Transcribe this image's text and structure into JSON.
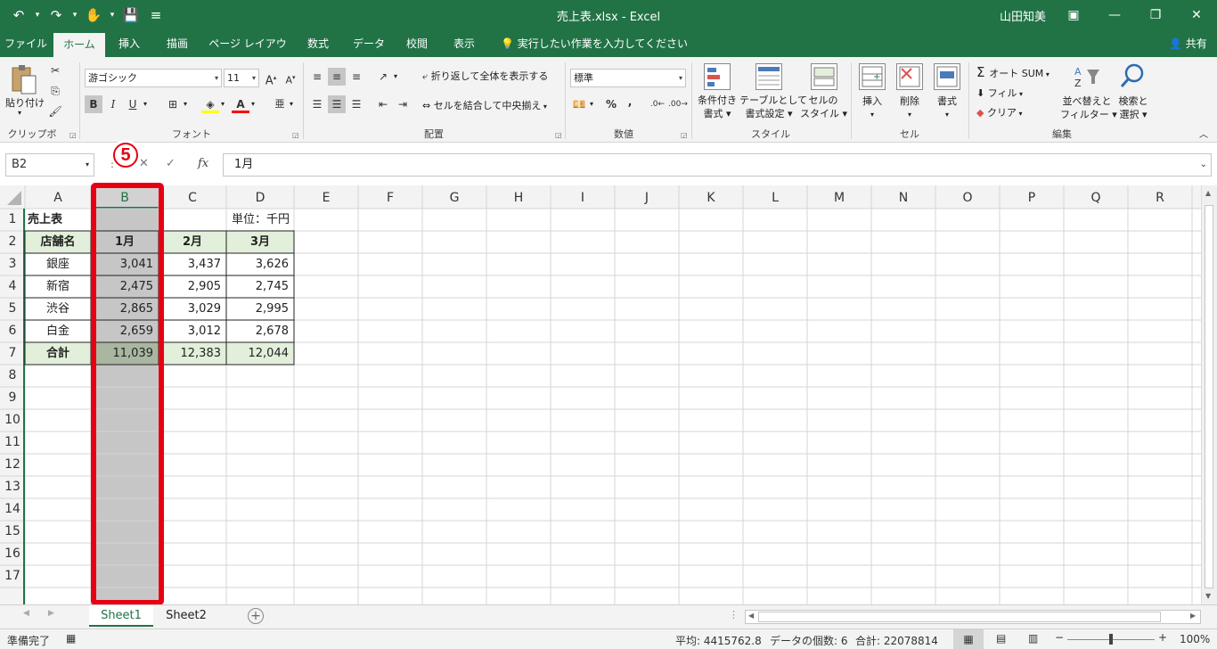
{
  "titlebar": {
    "qat_undo": "↶",
    "qat_redo": "↷",
    "qat_touch": "✋",
    "qat_save": "💾",
    "qat_more": "≡",
    "title": "売上表.xlsx  -  Excel",
    "user": "山田知美",
    "ribbon_display_icon": "▣",
    "minimize": "—",
    "restore": "❐",
    "close": "✕"
  },
  "tabs": [
    "ファイル",
    "ホーム",
    "挿入",
    "描画",
    "ページ レイアウト",
    "数式",
    "データ",
    "校閲",
    "表示"
  ],
  "tell_me": "実行したい作業を入力してください",
  "share": "共有",
  "ribbon": {
    "clipboard": {
      "paste": "貼り付け",
      "label": "クリップボード"
    },
    "font": {
      "name": "游ゴシック",
      "size": "11",
      "bold": "B",
      "italic": "I",
      "underline": "U",
      "grow": "A",
      "shrink": "A",
      "label": "フォント"
    },
    "alignment": {
      "wrap": "折り返して全体を表示する",
      "merge": "セルを結合して中央揃え",
      "label": "配置"
    },
    "number": {
      "format": "標準",
      "percent": "%",
      "comma": ",",
      "label": "数値"
    },
    "styles": {
      "conditional": [
        "条件付き",
        "書式"
      ],
      "table": [
        "テーブルとして",
        "書式設定"
      ],
      "cell": [
        "セルの",
        "スタイル"
      ],
      "label": "スタイル"
    },
    "cells": {
      "insert": "挿入",
      "delete": "削除",
      "format": "書式",
      "label": "セル"
    },
    "editing": {
      "autosum": "オート SUM",
      "fill": "フィル",
      "clear": "クリア",
      "sort": [
        "並べ替えと",
        "フィルター"
      ],
      "find": [
        "検索と",
        "選択"
      ],
      "label": "編集"
    }
  },
  "formula_bar": {
    "name_box": "B2",
    "formula": "1月",
    "fx": "fx"
  },
  "marker": "5",
  "columns": [
    "A",
    "B",
    "C",
    "D",
    "E",
    "F",
    "G",
    "H",
    "I",
    "J",
    "K",
    "L",
    "M",
    "N",
    "O",
    "P",
    "Q",
    "R"
  ],
  "rows": [
    "1",
    "2",
    "3",
    "4",
    "5",
    "6",
    "7",
    "8",
    "9",
    "10",
    "11",
    "12",
    "13",
    "14",
    "15",
    "16",
    "17"
  ],
  "cells": {
    "A1": "売上表",
    "D1": "単位：千円",
    "A2": "店舗名",
    "B2": "1月",
    "C2": "2月",
    "D2": "3月",
    "A3": "銀座",
    "B3": "3,041",
    "C3": "3,437",
    "D3": "3,626",
    "A4": "新宿",
    "B4": "2,475",
    "C4": "2,905",
    "D4": "2,745",
    "A5": "渋谷",
    "B5": "2,865",
    "C5": "3,029",
    "D5": "2,995",
    "A6": "白金",
    "B6": "2,659",
    "C6": "3,012",
    "D6": "2,678",
    "A7": "合計",
    "B7": "11,039",
    "C7": "12,383",
    "D7": "12,044"
  },
  "sheets": [
    "Sheet1",
    "Sheet2"
  ],
  "status": {
    "ready": "準備完了",
    "average": "平均: 4415762.8",
    "count": "データの個数: 6",
    "sum": "合計: 22078814",
    "zoom": "100%"
  },
  "colors": {
    "accent": "#217346",
    "highlight": "#e60012",
    "header_fill": "#e2efda",
    "selection": "#c6c6c6"
  }
}
